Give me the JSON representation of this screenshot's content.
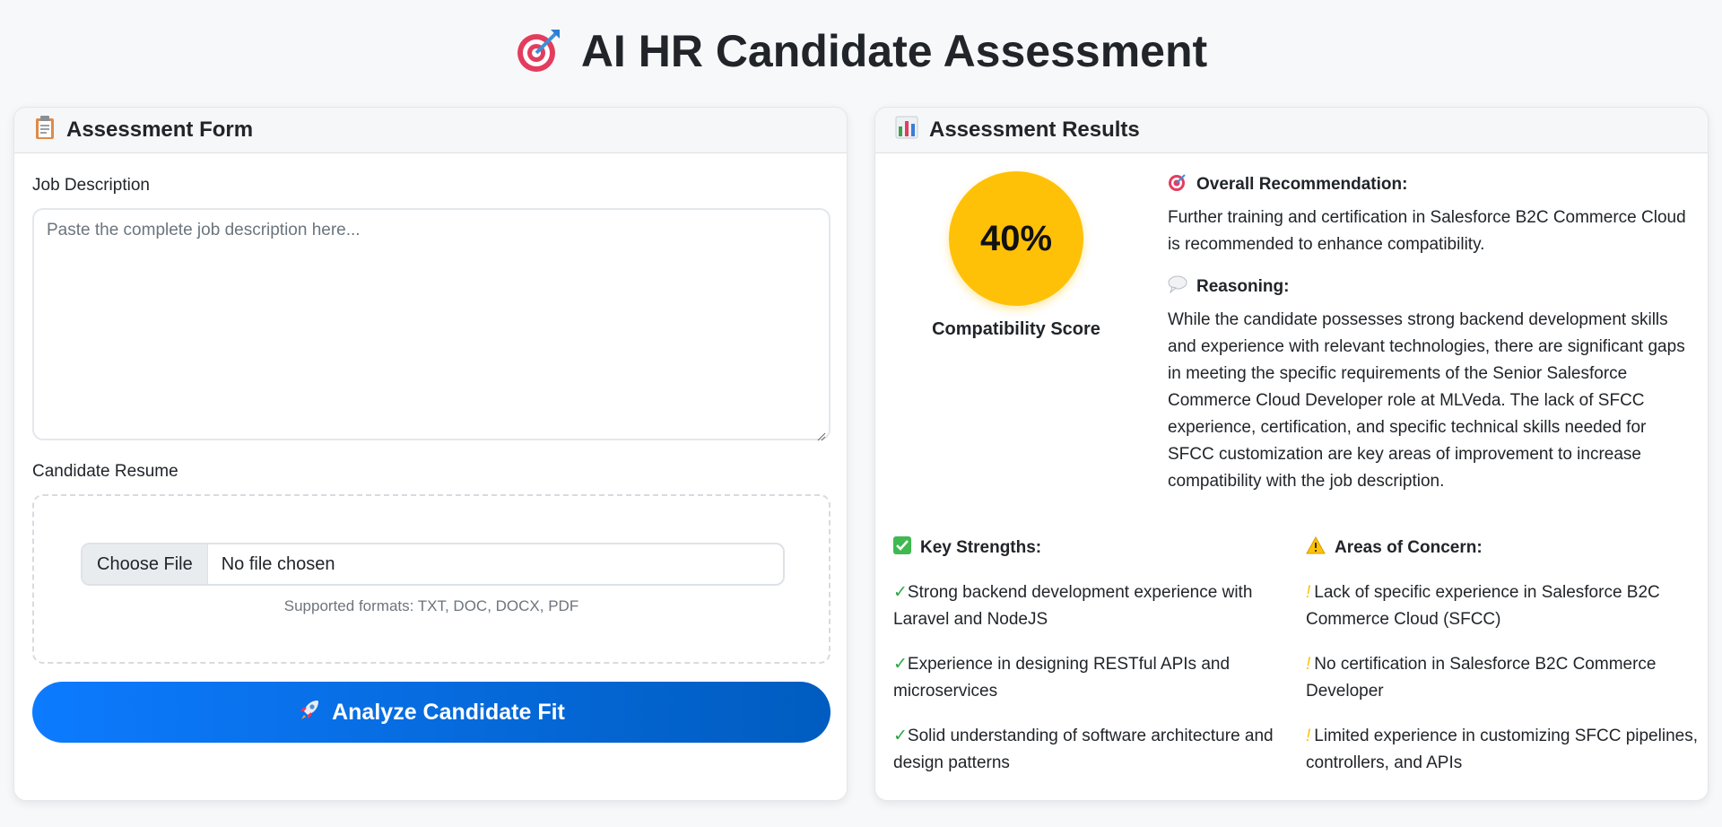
{
  "page": {
    "title": "AI HR Candidate Assessment",
    "title_icon": "target-icon"
  },
  "form": {
    "header": "Assessment Form",
    "header_icon": "clipboard-icon",
    "job_description_label": "Job Description",
    "job_description_placeholder": "Paste the complete job description here...",
    "job_description_value": "",
    "resume_label": "Candidate Resume",
    "choose_file_label": "Choose File",
    "file_status": "No file chosen",
    "supported_formats": "Supported formats: TXT, DOC, DOCX, PDF",
    "analyze_button": "Analyze Candidate Fit",
    "analyze_icon": "rocket-icon"
  },
  "results": {
    "header": "Assessment Results",
    "header_icon": "bar-chart-icon",
    "score": "40%",
    "score_value": 40,
    "score_label": "Compatibility Score",
    "score_color": "#ffc107",
    "recommendation_heading": "Overall Recommendation:",
    "recommendation_text": "Further training and certification in Salesforce B2C Commerce Cloud is recommended to enhance compatibility.",
    "reasoning_heading": "Reasoning:",
    "reasoning_text": "While the candidate possesses strong backend development skills and experience with relevant technologies, there are significant gaps in meeting the specific requirements of the Senior Salesforce Commerce Cloud Developer role at MLVeda. The lack of SFCC experience, certification, and specific technical skills needed for SFCC customization are key areas of improvement to increase compatibility with the job description.",
    "strengths_heading": "Key Strengths:",
    "strengths": [
      "Strong backend development experience with Laravel and NodeJS",
      "Experience in designing RESTful APIs and microservices",
      "Solid understanding of software architecture and design patterns"
    ],
    "concerns_heading": "Areas of Concern:",
    "concerns": [
      "Lack of specific experience in Salesforce B2C Commerce Cloud (SFCC)",
      "No certification in Salesforce B2C Commerce Developer",
      "Limited experience in customizing SFCC pipelines, controllers, and APIs"
    ],
    "check_glyph": "✓",
    "warn_glyph": "!"
  },
  "colors": {
    "primary": "#0d7bff",
    "primary_dark": "#005cbf",
    "warning": "#ffc107",
    "success": "#28a745"
  }
}
